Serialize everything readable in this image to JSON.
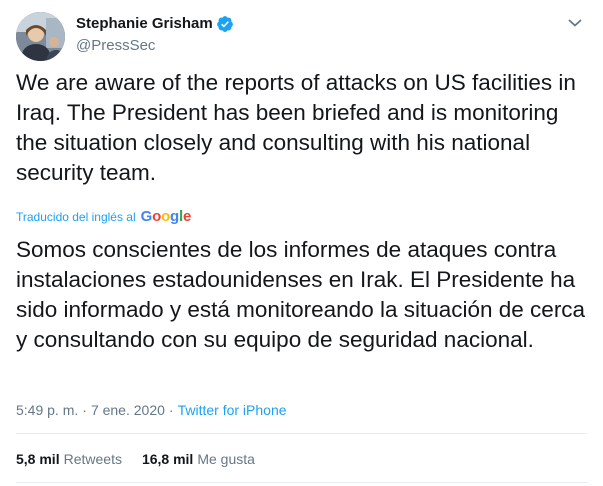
{
  "author": {
    "display_name": "Stephanie Grisham",
    "handle": "@PressSec",
    "verified": true
  },
  "tweet": {
    "text": "We are aware of the reports of attacks on US facilities in Iraq. The President has been briefed and is monitoring the situation closely and consulting with his national security team.",
    "translated_label": "Traducido del inglés al",
    "translation_provider": "Google",
    "translation": "Somos conscientes de los informes de ataques contra instalaciones estadounidenses en Irak. El Presidente ha sido informado y está monitoreando la situación de cerca y consultando con su equipo de seguridad nacional.",
    "time": "5:49 p. m.",
    "date": "7 ene. 2020",
    "separator": "·",
    "source": "Twitter for iPhone"
  },
  "stats": {
    "retweets_count": "5,8 mil",
    "retweets_label": "Retweets",
    "likes_count": "16,8 mil",
    "likes_label": "Me gusta"
  },
  "icons": {
    "verified": "verified-badge-icon",
    "caret": "chevron-down-icon"
  },
  "colors": {
    "accent": "#1da1f2",
    "text": "#14171a",
    "secondary": "#657786",
    "google_blue": "#4285f4",
    "google_red": "#ea4335",
    "google_yellow": "#fbbc05",
    "google_green": "#34a853"
  }
}
